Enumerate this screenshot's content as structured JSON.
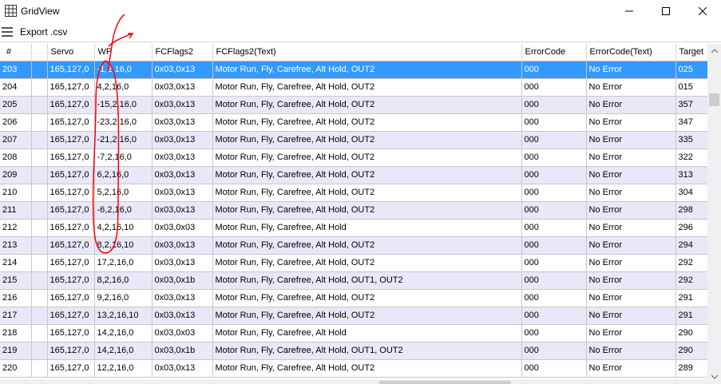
{
  "window": {
    "title": "GridView",
    "icons": {
      "app": "grid-icon",
      "minimize": "minimize-icon",
      "maximize": "maximize-icon",
      "close": "close-icon"
    }
  },
  "toolbar": {
    "menu_icon": "hamburger-menu-icon",
    "export_label": "Export .csv"
  },
  "grid": {
    "columns": [
      "#",
      "",
      "Servo",
      "WP",
      "FCFlags2",
      "FCFlags2(Text)",
      "ErrorCode",
      "ErrorCode(Text)",
      "Target"
    ],
    "selected_row": 0,
    "rows": [
      [
        "203",
        "",
        "165,127,0",
        "-1,2,16,0",
        "0x03,0x13",
        "Motor Run, Fly, Carefree, Alt Hold, OUT2",
        "000",
        "No Error",
        "025"
      ],
      [
        "204",
        "",
        "165,127,0",
        "4,2,16,0",
        "0x03,0x13",
        "Motor Run, Fly, Carefree, Alt Hold, OUT2",
        "000",
        "No Error",
        "015"
      ],
      [
        "205",
        "",
        "165,127,0",
        "-15,2,16,0",
        "0x03,0x13",
        "Motor Run, Fly, Carefree, Alt Hold, OUT2",
        "000",
        "No Error",
        "357"
      ],
      [
        "206",
        "",
        "165,127,0",
        "-23,2,16,0",
        "0x03,0x13",
        "Motor Run, Fly, Carefree, Alt Hold, OUT2",
        "000",
        "No Error",
        "347"
      ],
      [
        "207",
        "",
        "165,127,0",
        "-21,2,16,0",
        "0x03,0x13",
        "Motor Run, Fly, Carefree, Alt Hold, OUT2",
        "000",
        "No Error",
        "335"
      ],
      [
        "208",
        "",
        "165,127,0",
        "-7,2,16,0",
        "0x03,0x13",
        "Motor Run, Fly, Carefree, Alt Hold, OUT2",
        "000",
        "No Error",
        "322"
      ],
      [
        "209",
        "",
        "165,127,0",
        "6,2,16,0",
        "0x03,0x13",
        "Motor Run, Fly, Carefree, Alt Hold, OUT2",
        "000",
        "No Error",
        "313"
      ],
      [
        "210",
        "",
        "165,127,0",
        "5,2,16,0",
        "0x03,0x13",
        "Motor Run, Fly, Carefree, Alt Hold, OUT2",
        "000",
        "No Error",
        "304"
      ],
      [
        "211",
        "",
        "165,127,0",
        "-6,2,16,0",
        "0x03,0x13",
        "Motor Run, Fly, Carefree, Alt Hold, OUT2",
        "000",
        "No Error",
        "298"
      ],
      [
        "212",
        "",
        "165,127,0",
        "4,2,16,10",
        "0x03,0x03",
        "Motor Run, Fly, Carefree, Alt Hold",
        "000",
        "No Error",
        "296"
      ],
      [
        "213",
        "",
        "165,127,0",
        "8,2,16,10",
        "0x03,0x13",
        "Motor Run, Fly, Carefree, Alt Hold, OUT2",
        "000",
        "No Error",
        "294"
      ],
      [
        "214",
        "",
        "165,127,0",
        "17,2,16,0",
        "0x03,0x13",
        "Motor Run, Fly, Carefree, Alt Hold, OUT2",
        "000",
        "No Error",
        "292"
      ],
      [
        "215",
        "",
        "165,127,0",
        "8,2,16,0",
        "0x03,0x1b",
        "Motor Run, Fly, Carefree, Alt Hold, OUT1, OUT2",
        "000",
        "No Error",
        "292"
      ],
      [
        "216",
        "",
        "165,127,0",
        "9,2,16,0",
        "0x03,0x13",
        "Motor Run, Fly, Carefree, Alt Hold, OUT2",
        "000",
        "No Error",
        "291"
      ],
      [
        "217",
        "",
        "165,127,0",
        "13,2,16,10",
        "0x03,0x13",
        "Motor Run, Fly, Carefree, Alt Hold, OUT2",
        "000",
        "No Error",
        "291"
      ],
      [
        "218",
        "",
        "165,127,0",
        "14,2,16,0",
        "0x03,0x03",
        "Motor Run, Fly, Carefree, Alt Hold",
        "000",
        "No Error",
        "290"
      ],
      [
        "219",
        "",
        "165,127,0",
        "14,2,16,0",
        "0x03,0x1b",
        "Motor Run, Fly, Carefree, Alt Hold, OUT1, OUT2",
        "000",
        "No Error",
        "290"
      ],
      [
        "220",
        "",
        "165,127,0",
        "12,2,16,0",
        "0x03,0x13",
        "Motor Run, Fly, Carefree, Alt Hold, OUT2",
        "000",
        "No Error",
        "289"
      ]
    ]
  },
  "colors": {
    "selection": "#3399ff",
    "alt_row": "#e8e8f8",
    "annotation": "#ff0000"
  }
}
